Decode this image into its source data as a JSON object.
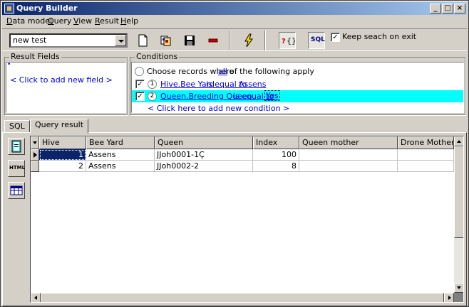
{
  "window": {
    "title": "Query Builder"
  },
  "menu": [
    {
      "label": "Data model",
      "u": "D",
      "rest": "ata model"
    },
    {
      "label": "Query",
      "u": "Q",
      "rest": "uery"
    },
    {
      "label": "View",
      "u": "V",
      "rest": "iew"
    },
    {
      "label": "Result",
      "u": "R",
      "rest": "esult"
    },
    {
      "label": "Help",
      "u": "H",
      "rest": "elp"
    }
  ],
  "toolbar": {
    "query_name": "new test",
    "sql_label": "SQL",
    "keep_search_label": "Keep seach on exit",
    "keep_search_checked": true
  },
  "result_fields": {
    "label": "Result Fields",
    "marker": "•",
    "add_text": "< Click to add new field >"
  },
  "conditions": {
    "label": "Conditions",
    "choose_prefix": "Choose records where",
    "quantifier": "all",
    "choose_suffix": "of the following apply",
    "rows": [
      {
        "num": "1",
        "field": "Hive.Bee Yard",
        "operator": "is equal to",
        "value": "Assens",
        "checked": true,
        "selected": false
      },
      {
        "num": "2",
        "field": "Queen.Breeding Queen",
        "operator": "is equal to",
        "value": "Yes",
        "checked": true,
        "selected": true
      }
    ],
    "add_text": "< Click here to add new condition >"
  },
  "tabs": [
    {
      "label": "SQL",
      "active": false
    },
    {
      "label": "Query result",
      "active": true
    }
  ],
  "side_buttons": [
    {
      "name": "export-icon",
      "text": ""
    },
    {
      "name": "html-export-icon",
      "text": "HTML"
    },
    {
      "name": "table-view-icon",
      "text": ""
    }
  ],
  "grid": {
    "columns": [
      "Hive",
      "Bee Yard",
      "Queen",
      "Index",
      "Queen mother",
      "Drone Mother"
    ],
    "rows": [
      [
        "1",
        "Assens",
        "JJoh0001-1Ç",
        "100",
        "",
        ""
      ],
      [
        "2",
        "Assens",
        "JJoh0002-2",
        "8",
        "",
        ""
      ]
    ]
  },
  "colors": {
    "selection": "#00ffff",
    "link": "#0000e0",
    "title_start": "#0a246a"
  }
}
